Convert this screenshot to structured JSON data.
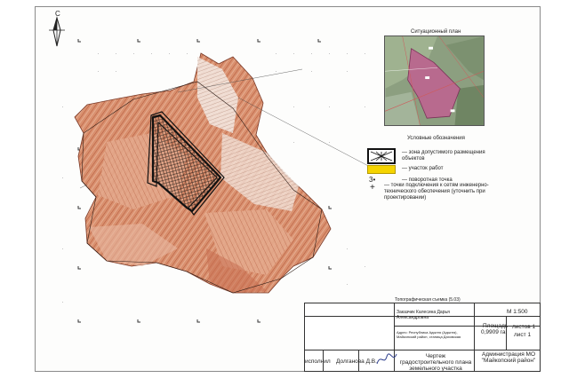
{
  "north_arrow": {
    "label": "С"
  },
  "situation_plan": {
    "title": "Ситуационный план"
  },
  "legend": {
    "title": "Условные обозначения",
    "items": [
      {
        "label": "— зона допустимого размещения объектов"
      },
      {
        "label": "— участок работ"
      },
      {
        "symbol": "3•",
        "label": "— поворотная точка"
      },
      {
        "label": "— точки подключения к сетям инженерно-технического обеспечения (уточнить при проектировании)"
      }
    ]
  },
  "title_block": {
    "survey_label": "Топографическая съемка (5.03)",
    "customer": "Заказчик Калесина Дарья Александровна",
    "scale": "М 1:500",
    "address": "Адрес: Республика Адыгея (Адыгея), Майкопский район, станица Даховская",
    "area_label": "Площадь",
    "area_value": "0,9909 га",
    "sheets_label": "листов 1",
    "sheet_label": "лист 1",
    "executor_label": "исполнил",
    "executor_name": "Долганова Д.В.",
    "drawing_title": "Чертеж градостроительного плана земельного участка",
    "organization": "Администрация МО \"Майкопский район\""
  },
  "colors": {
    "terrain": "#d88a6a",
    "terrain_dark": "#b8553a",
    "zone_hatch": "#1a1a1a",
    "situation_bg": "#8aa07c",
    "situation_plot": "#b96a8c",
    "legend_yellow": "#f5d400"
  },
  "icons": {
    "north": "north-arrow-icon",
    "connection": "cross-plus-icon",
    "zone": "hatched-zone-icon",
    "plot": "yellow-plot-icon"
  }
}
